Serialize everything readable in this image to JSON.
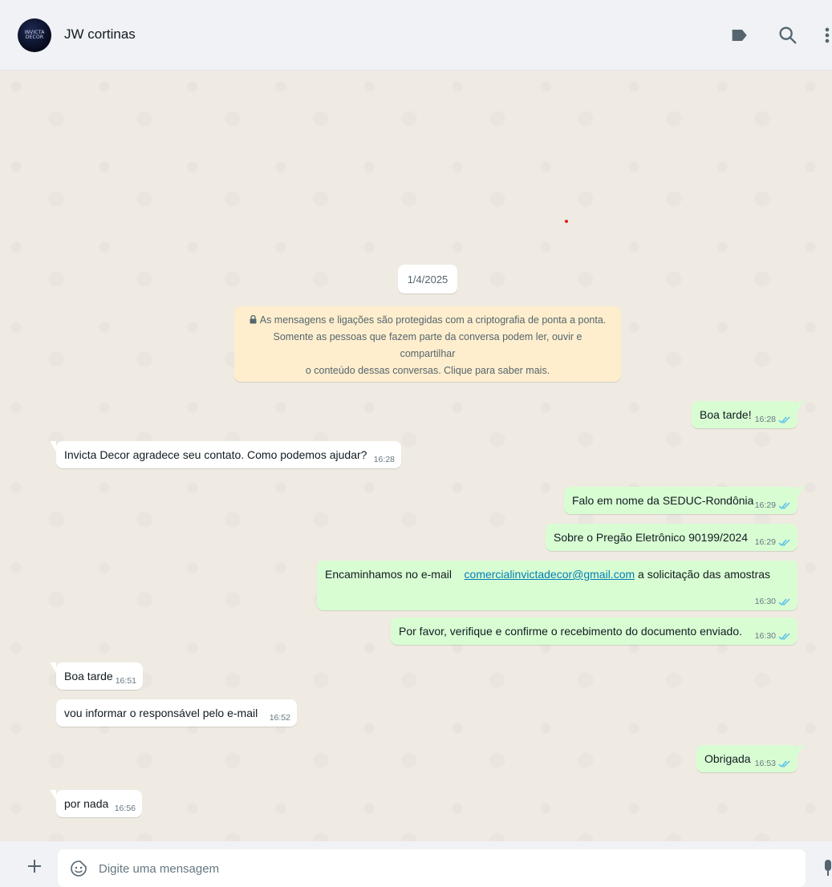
{
  "header": {
    "contact_name": "JW cortinas",
    "avatar_text": [
      "INVICTA",
      "DECOR"
    ],
    "icons": [
      "label-icon",
      "search-icon",
      "menu-icon"
    ]
  },
  "chat": {
    "date_chip": "1/4/2025",
    "encryption_notice": {
      "line1": "As mensagens e ligações são protegidas com a criptografia de ponta a ponta.",
      "line2": "Somente as pessoas que fazem parte da conversa podem ler, ouvir e compartilhar",
      "line3": "o conteúdo dessas conversas. Clique para saber mais."
    },
    "messages": [
      {
        "dir": "out",
        "text": "Boa tarde!",
        "time": "16:28"
      },
      {
        "dir": "in",
        "text": "Invicta Decor agradece seu contato. Como podemos ajudar?",
        "time": "16:28"
      },
      {
        "dir": "out",
        "text": "Falo em nome da SEDUC-Rondônia",
        "time": "16:29"
      },
      {
        "dir": "out",
        "text": "Sobre o Pregão Eletrônico 90199/2024",
        "time": "16:29"
      },
      {
        "dir": "out",
        "text_before": "Encaminhamos no e-mail",
        "link": "comercialinvictadecor@gmail.com",
        "text_after": "a solicitação das amostras",
        "time": "16:30"
      },
      {
        "dir": "out",
        "text": "Por favor, verifique e confirme o recebimento do documento enviado.",
        "time": "16:30"
      },
      {
        "dir": "in",
        "text": "Boa tarde",
        "time": "16:51"
      },
      {
        "dir": "in",
        "text": "vou informar o responsável pelo e-mail",
        "time": "16:52"
      },
      {
        "dir": "out",
        "text": "Obrigada",
        "time": "16:53"
      },
      {
        "dir": "in",
        "text": "por nada",
        "time": "16:56"
      }
    ]
  },
  "composer": {
    "placeholder": "Digite uma mensagem"
  },
  "colors": {
    "outgoing_bubble": "#d9fdd3",
    "incoming_bubble": "#ffffff",
    "chat_background": "#efeae2",
    "read_ticks": "#53bdeb",
    "link": "#027eb5"
  }
}
